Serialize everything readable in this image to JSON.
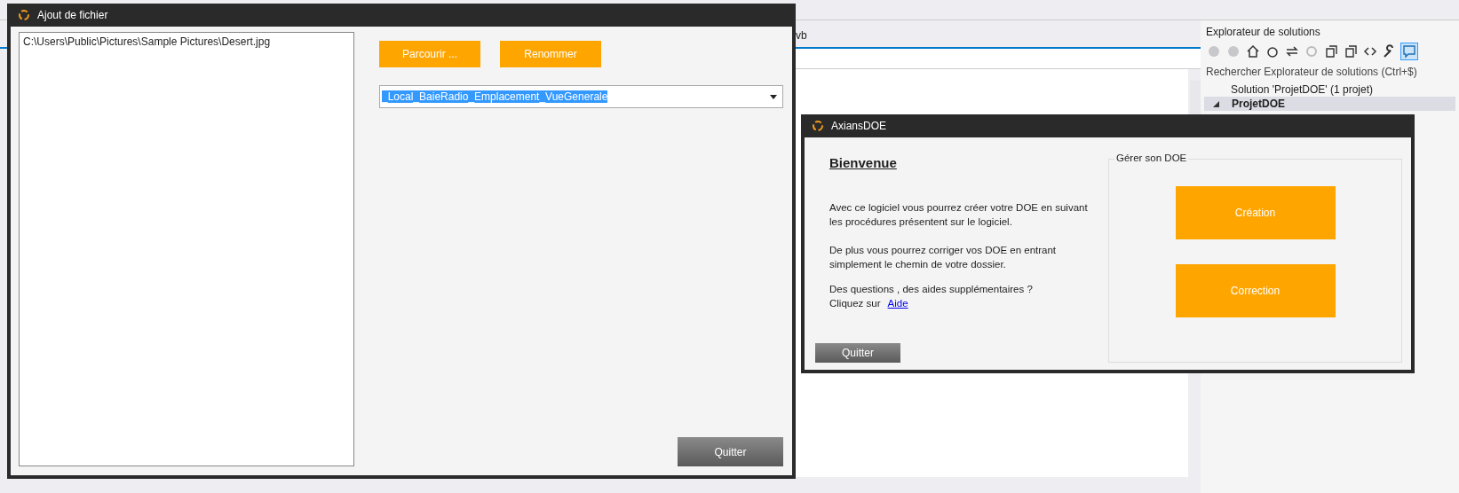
{
  "ide": {
    "editor_tab": "vb",
    "solution_explorer": {
      "title": "Explorateur de solutions",
      "search": {
        "placeholder": "Rechercher Explorateur de solutions (Ctrl+$)"
      },
      "tree": [
        {
          "label": "Solution 'ProjetDOE' (1 projet)",
          "selected": false,
          "children": [
            {
              "label": "ProjetDOE",
              "selected": true,
              "expanded": true
            }
          ]
        }
      ]
    }
  },
  "file_dialog": {
    "title": "Ajout de fichier",
    "files": [
      {
        "path": "C:\\Users\\Public\\Pictures\\Sample Pictures\\Desert.jpg",
        "selected": false
      }
    ],
    "browse_button": "Parcourir ...",
    "rename_button": "Renommer",
    "name_combo": {
      "value": "_Local_BaieRadio_Emplacement_VueGenerale",
      "text_selected": true
    },
    "quit_button": "Quitter"
  },
  "main_window": {
    "title": "AxiansDOE",
    "heading": "Bienvenue",
    "paragraphs": [
      "Avec ce logiciel vous pourrez créer votre DOE en suivant les procédures présentent sur le logiciel.",
      "De plus vous pourrez corriger vos DOE en entrant simplement le chemin de votre dossier."
    ],
    "help_question": "Des questions , des aides supplémentaires ?",
    "help_prompt": "Cliquez sur",
    "help_link": "Aide",
    "group_title": "Gérer son DOE",
    "actions": [
      "Création",
      "Correction"
    ],
    "quit_button": "Quitter"
  }
}
